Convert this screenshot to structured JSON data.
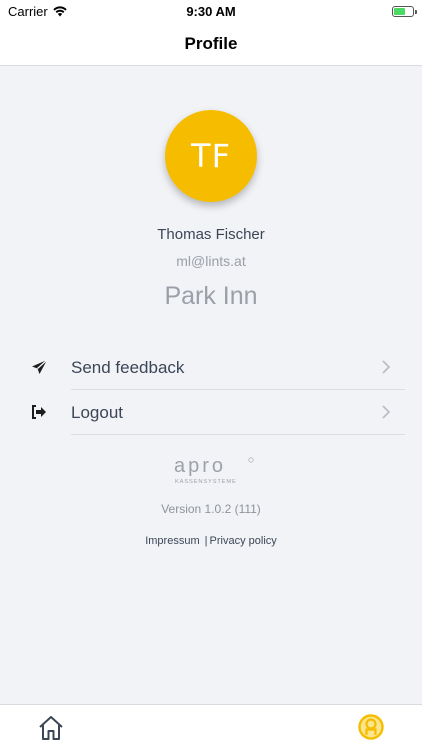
{
  "status_bar": {
    "carrier": "Carrier",
    "time": "9:30 AM",
    "battery_level": 0.6
  },
  "header": {
    "title": "Profile"
  },
  "profile": {
    "initials": "TF",
    "name": "Thomas Fischer",
    "email": "ml@lints.at",
    "location": "Park Inn",
    "avatar_color": "#f6bd00"
  },
  "menu": {
    "items": [
      {
        "label": "Send feedback",
        "icon": "send-icon"
      },
      {
        "label": "Logout",
        "icon": "logout-icon"
      }
    ]
  },
  "footer": {
    "brand_name": "apro",
    "brand_tagline": "KASSENSYSTEME",
    "version": "Version 1.0.2 (111)",
    "impressum_label": "Impressum",
    "separator": "|",
    "privacy_label": "Privacy policy"
  },
  "tab_bar": {
    "tabs": [
      {
        "name": "home",
        "icon": "home-icon",
        "active": false
      },
      {
        "name": "profile",
        "icon": "profile-icon",
        "active": true
      }
    ],
    "active_color": "#f6bd00"
  }
}
